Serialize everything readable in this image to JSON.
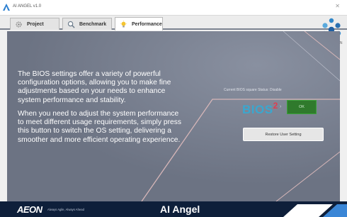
{
  "window": {
    "title": "AI ANGEL v1.0"
  },
  "tabs": [
    {
      "label": "Project",
      "icon": "gear-icon",
      "active": false
    },
    {
      "label": "Benchmark",
      "icon": "magnifier-icon",
      "active": false
    },
    {
      "label": "Performance",
      "icon": "lightbulb-icon",
      "active": true
    }
  ],
  "corner_logo": {
    "text": "A·EON"
  },
  "description": {
    "paragraph1": "The BIOS settings offer a variety of powerful configuration options, allowing you to make fine adjustments based on your needs to enhance system performance and stability.",
    "paragraph2": "When you need to adjust the system performance to meet different usage requirements, simply press this button to switch the OS setting, delivering a smoother and more efficient operating experience."
  },
  "bios_panel": {
    "status_text": "Current BIOS square Status: Disable",
    "logo_text": "BIOS",
    "logo_superscript": "2",
    "chevron": "›",
    "ok_label": "OK",
    "ok_color": "#2f7a2c",
    "restore_label": "Restore User Setting"
  },
  "footer": {
    "brand": "AEON",
    "tagline": "Always Agile, Always Ahead",
    "product_name": "AI Angel"
  },
  "colors": {
    "panel_bg": "#6c7383",
    "footer_bg": "#0e1f3a",
    "accent_blue": "#3aa7cf",
    "accent_red": "#e23c50"
  }
}
